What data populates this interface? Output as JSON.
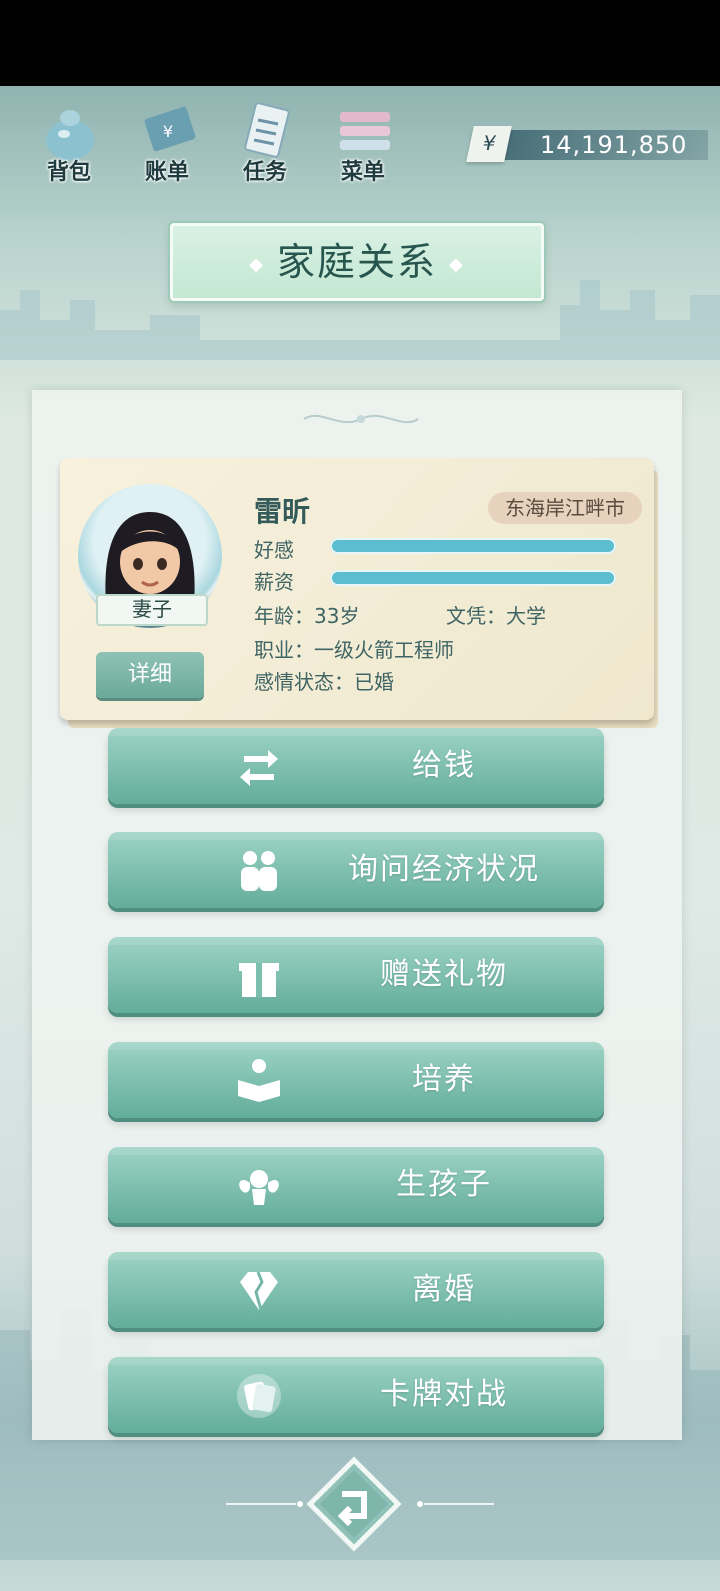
{
  "toolbar": {
    "items": [
      {
        "label": "背包",
        "icon": "bag-icon"
      },
      {
        "label": "账单",
        "icon": "bill-icon"
      },
      {
        "label": "任务",
        "icon": "task-icon"
      },
      {
        "label": "菜单",
        "icon": "menu-icon"
      }
    ]
  },
  "money": {
    "symbol": "¥",
    "amount": "14,191,850"
  },
  "page_title": "家庭关系",
  "member": {
    "name": "雷昕",
    "role": "妻子",
    "city": "东海岸江畔市",
    "affection_label": "好感",
    "affection_level": 1.0,
    "salary_label": "薪资",
    "salary_level": 1.0,
    "age": "年龄：33岁",
    "education": "文凭：大学",
    "job": "职业：一级火箭工程师",
    "relationship": "感情状态：已婚",
    "detail_label": "详细"
  },
  "actions": [
    {
      "label": "给钱",
      "icon": "transfer-icon"
    },
    {
      "label": "询问经济状况",
      "icon": "people-icon"
    },
    {
      "label": "赠送礼物",
      "icon": "gift-icon"
    },
    {
      "label": "培养",
      "icon": "reading-icon"
    },
    {
      "label": "生孩子",
      "icon": "angel-baby-icon"
    },
    {
      "label": "离婚",
      "icon": "broken-diamond-icon"
    },
    {
      "label": "卡牌对战",
      "icon": "cards-icon"
    }
  ],
  "colors": {
    "accent": "#63ad9b",
    "meter": "#5bbdcf",
    "title_text": "#28564f"
  }
}
